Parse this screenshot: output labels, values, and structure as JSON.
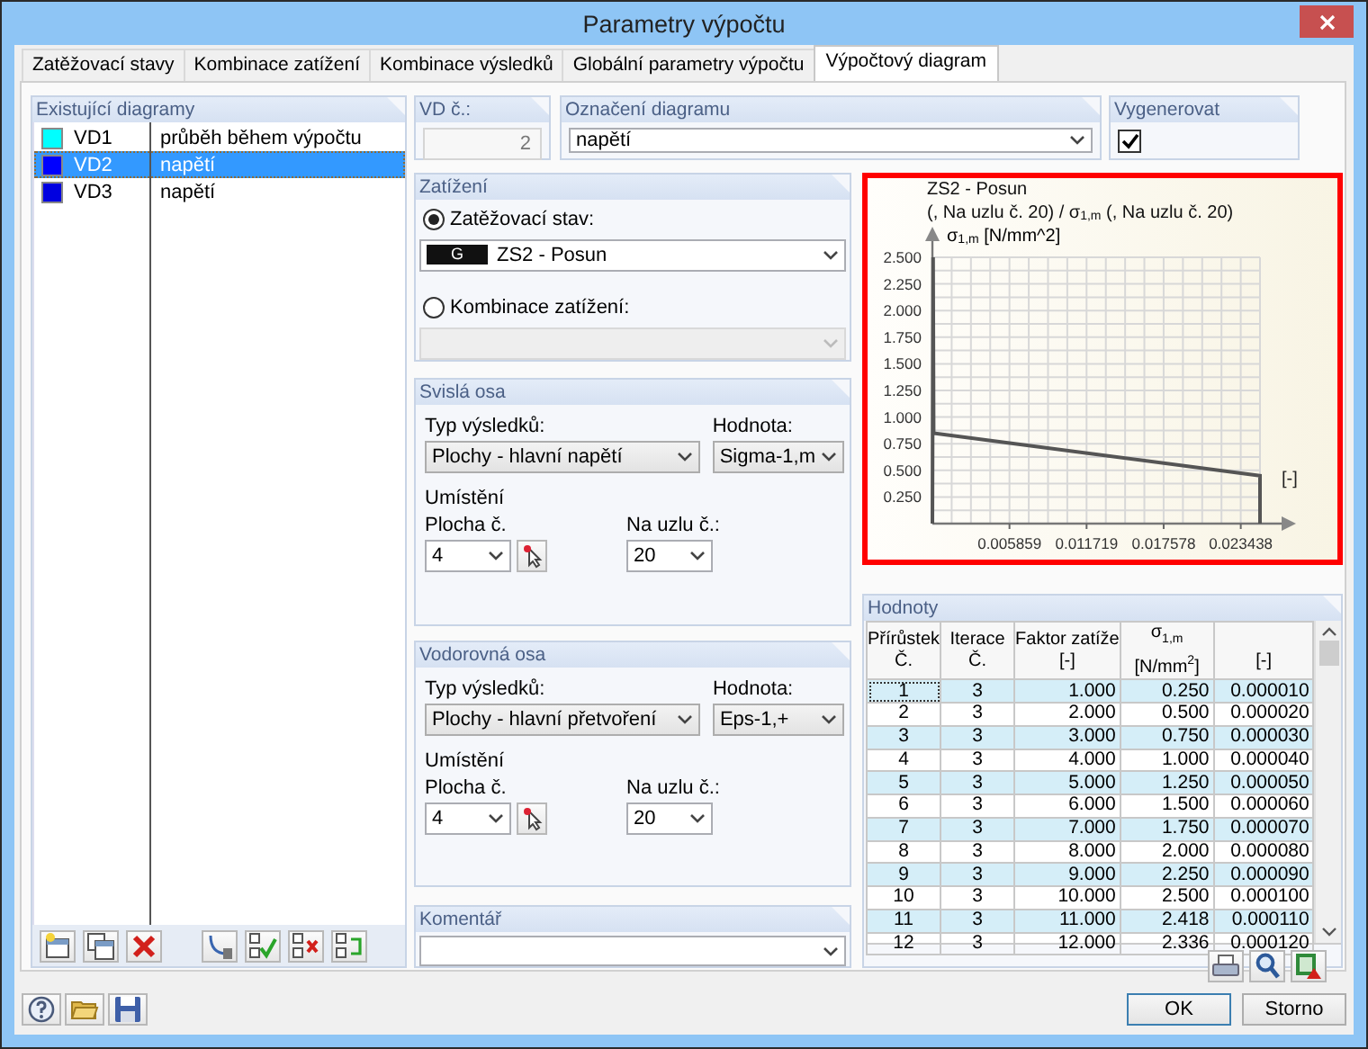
{
  "window": {
    "title": "Parametry výpočtu"
  },
  "tabs": [
    {
      "label": "Zatěžovací stavy",
      "selected": false
    },
    {
      "label": "Kombinace zatížení",
      "selected": false
    },
    {
      "label": "Kombinace výsledků",
      "selected": false
    },
    {
      "label": "Globální parametry výpočtu",
      "selected": false
    },
    {
      "label": "Výpočtový diagram",
      "selected": true
    }
  ],
  "existing_diagrams": {
    "title": "Existující diagramy",
    "items": [
      {
        "code": "VD1",
        "name": "průběh během výpočtu",
        "color": "#00ffff",
        "selected": false
      },
      {
        "code": "VD2",
        "name": "napětí",
        "color": "#0000ff",
        "selected": true
      },
      {
        "code": "VD3",
        "name": "napětí",
        "color": "#0000e0",
        "selected": false
      }
    ]
  },
  "vd_number": {
    "label": "VD č.:",
    "value": "2",
    "disabled": true
  },
  "diagram_name": {
    "label": "Označení diagramu",
    "value": "napětí"
  },
  "generate": {
    "label": "Vygenerovat",
    "checked": true
  },
  "load": {
    "title": "Zatížení",
    "load_case": {
      "label": "Zatěžovací stav:",
      "selected": true,
      "badge": "G",
      "value": "ZS2 - Posun"
    },
    "combination": {
      "label": "Kombinace zatížení:",
      "selected": false,
      "disabled": true
    }
  },
  "vertical_axis": {
    "title": "Svislá osa",
    "result_type_label": "Typ výsledků:",
    "result_type": "Plochy - hlavní napětí",
    "value_label": "Hodnota:",
    "value": "Sigma-1,m",
    "location_label": "Umístění",
    "surface_label": "Plocha č.",
    "surface": "4",
    "node_label": "Na uzlu č.:",
    "node": "20"
  },
  "horizontal_axis": {
    "title": "Vodorovná osa",
    "result_type_label": "Typ výsledků:",
    "result_type": "Plochy - hlavní přetvoření",
    "value_label": "Hodnota:",
    "value": "Eps-1,+",
    "location_label": "Umístění",
    "surface_label": "Plocha č.",
    "surface": "4",
    "node_label": "Na uzlu č.:",
    "node": "20"
  },
  "comment": {
    "label": "Komentář"
  },
  "chart": {
    "caption": [
      "ZS2 - Posun",
      "(, Na uzlu č. 20) / σ$_{1,m}$ (, Na uzlu č. 20)"
    ],
    "chart_data": {
      "type": "line",
      "ylabel": "σ$_{1,m}$ [N/mm^2]",
      "xlabel": "[-]",
      "x": [
        0,
        5e-05,
        0.0001,
        0.0249,
        0.0249
      ],
      "series": [
        {
          "color": "#555555",
          "values": [
            0,
            2.5,
            0.85,
            0.45,
            0
          ]
        }
      ],
      "grid": true,
      "xlim": [
        0,
        0.0249
      ],
      "ylim": [
        0,
        2.5
      ],
      "xticks": [
        {
          "value": 0.005859,
          "label": "0.005859"
        },
        {
          "value": 0.011719,
          "label": "0.011719"
        },
        {
          "value": 0.017578,
          "label": "0.017578"
        },
        {
          "value": 0.023438,
          "label": "0.023438"
        }
      ],
      "yticks": [
        {
          "value": 0.25,
          "label": "0.250"
        },
        {
          "value": 0.5,
          "label": "0.500"
        },
        {
          "value": 0.75,
          "label": "0.750"
        },
        {
          "value": 1,
          "label": "1.000"
        },
        {
          "value": 1.25,
          "label": "1.250"
        },
        {
          "value": 1.5,
          "label": "1.500"
        },
        {
          "value": 1.75,
          "label": "1.750"
        },
        {
          "value": 2,
          "label": "2.000"
        },
        {
          "value": 2.25,
          "label": "2.250"
        },
        {
          "value": 2.5,
          "label": "2.500"
        }
      ]
    }
  },
  "values": {
    "title": "Hodnoty",
    "columns": [
      {
        "label": "Přírůstek",
        "unit": "Č."
      },
      {
        "label": "Iterace",
        "unit": "Č."
      },
      {
        "label": "Faktor zatíže",
        "unit": "[-]"
      },
      {
        "label": "σ$_{1,m}$",
        "unit": "[N/mm$^{2}$]"
      },
      {
        "unit": "[-]"
      }
    ],
    "rows": [
      {
        "cells": [
          "1",
          "3",
          "1.000",
          "0.250",
          "0.000010"
        ],
        "selected": true
      },
      {
        "cells": [
          "2",
          "3",
          "2.000",
          "0.500",
          "0.000020"
        ],
        "selected": false
      },
      {
        "cells": [
          "3",
          "3",
          "3.000",
          "0.750",
          "0.000030"
        ],
        "selected": false
      },
      {
        "cells": [
          "4",
          "3",
          "4.000",
          "1.000",
          "0.000040"
        ],
        "selected": false
      },
      {
        "cells": [
          "5",
          "3",
          "5.000",
          "1.250",
          "0.000050"
        ],
        "selected": false
      },
      {
        "cells": [
          "6",
          "3",
          "6.000",
          "1.500",
          "0.000060"
        ],
        "selected": false
      },
      {
        "cells": [
          "7",
          "3",
          "7.000",
          "1.750",
          "0.000070"
        ],
        "selected": false
      },
      {
        "cells": [
          "8",
          "3",
          "8.000",
          "2.000",
          "0.000080"
        ],
        "selected": false
      },
      {
        "cells": [
          "9",
          "3",
          "9.000",
          "2.250",
          "0.000090"
        ],
        "selected": false
      },
      {
        "cells": [
          "10",
          "3",
          "10.000",
          "2.500",
          "0.000100"
        ],
        "selected": false
      },
      {
        "cells": [
          "11",
          "3",
          "11.000",
          "2.418",
          "0.000110"
        ],
        "selected": false
      },
      {
        "cells": [
          "12",
          "3",
          "12.000",
          "2.336",
          "0.000120"
        ],
        "selected": false
      }
    ]
  },
  "buttons": [
    "OK",
    "Storno"
  ]
}
